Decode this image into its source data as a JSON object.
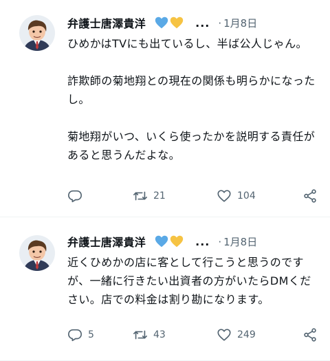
{
  "tweets": [
    {
      "author": "弁護士唐澤貴洋",
      "more": "...",
      "dot": "·",
      "date": "1月8日",
      "text": "ひめかはTVにも出ているし、半ば公人じゃん。\n\n詐欺師の菊地翔との現在の関係も明らかになったし。\n\n菊地翔がいつ、いくら使ったかを説明する責任があると思うんだよな。",
      "replies": "",
      "retweets": "21",
      "likes": "104",
      "icons": [
        "reply-icon",
        "retweet-icon",
        "heart-icon",
        "share-icon"
      ]
    },
    {
      "author": "弁護士唐澤貴洋",
      "more": "...",
      "dot": "·",
      "date": "1月8日",
      "text": "近くひめかの店に客として行こうと思うのですが、一緒に行きたい出資者の方がいたらDMください。店での料金は割り勘になります。",
      "replies": "5",
      "retweets": "43",
      "likes": "249",
      "icons": [
        "reply-icon",
        "retweet-icon",
        "heart-icon",
        "share-icon"
      ]
    }
  ],
  "colors": {
    "text": "#0f1419",
    "muted": "#536471",
    "heart_blue": "#5aa9e6",
    "heart_yellow": "#f6c343",
    "divider": "#eff3f4"
  }
}
